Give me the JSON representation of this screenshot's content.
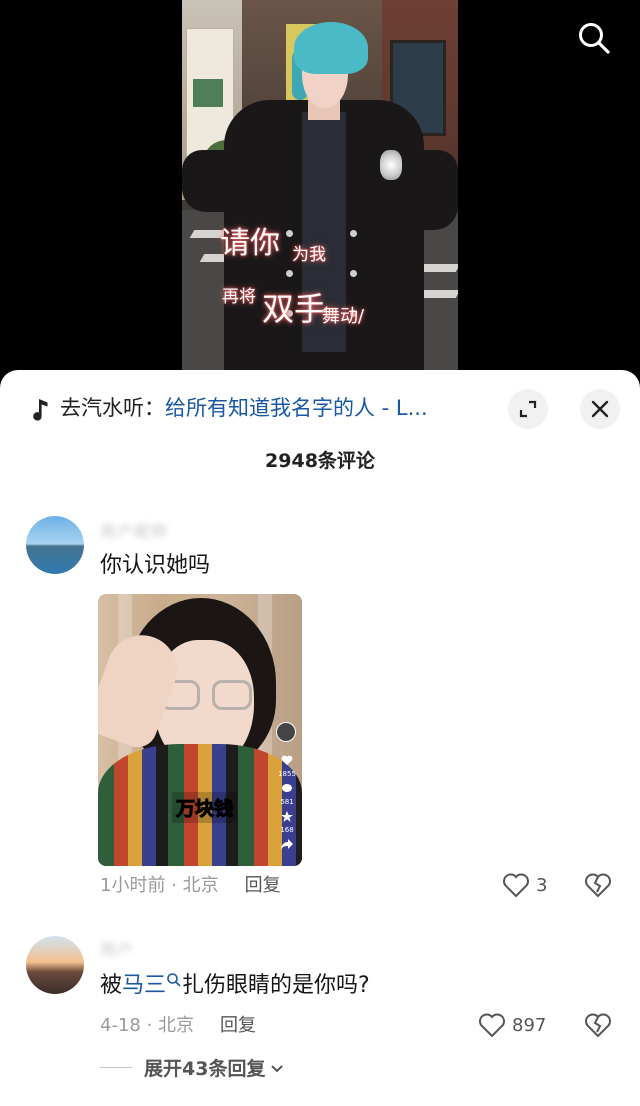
{
  "video": {
    "lyrics": [
      "请你",
      "为我",
      "再将",
      "双手",
      "舞动/"
    ]
  },
  "header": {
    "search_icon": "search-icon"
  },
  "music": {
    "prefix": "去汽水听：",
    "title": "给所有知道我名字的人 - L...",
    "icon": "music-note-icon"
  },
  "comments_header": {
    "count_label": "2948条评论"
  },
  "comments": [
    {
      "username": "用户昵称",
      "text": "你认识她吗",
      "image_caption": "万块钱",
      "image_side_counts": [
        "1855",
        "581",
        "168"
      ],
      "time_location": "1小时前 · 北京",
      "reply_label": "回复",
      "likes": "3"
    },
    {
      "username": "用户",
      "text_before": "被",
      "mention": "马三",
      "text_after": "扎伤眼睛的是你吗?",
      "time_location": "4-18 · 北京",
      "reply_label": "回复",
      "likes": "897",
      "expand_label": "展开43条回复"
    }
  ],
  "colors": {
    "link_blue": "#1a57a3",
    "sheet_bg": "#ffffff",
    "video_bg": "#000000"
  }
}
